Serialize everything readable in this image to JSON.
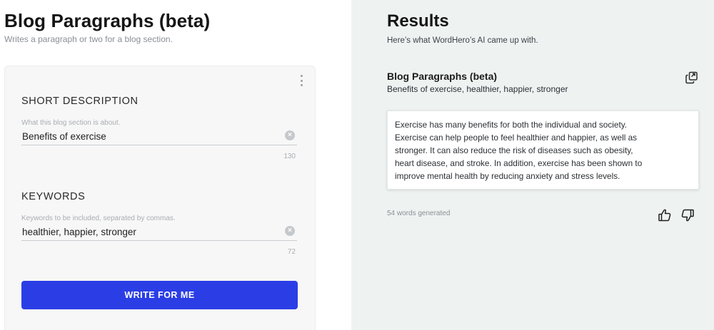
{
  "left": {
    "title": "Blog Paragraphs (beta)",
    "subtitle": "Writes a paragraph or two for a blog section.",
    "menu_icon": "kebab-vertical-icon",
    "short_description": {
      "label": "SHORT DESCRIPTION",
      "hint": "What this blog section is about.",
      "value": "Benefits of exercise",
      "counter": "130"
    },
    "keywords": {
      "label": "KEYWORDS",
      "hint": "Keywords to be included, separated by commas.",
      "value": "healthier, happier, stronger",
      "counter": "72"
    },
    "write_button_label": "WRITE FOR ME",
    "accent_color": "#2b3ee6"
  },
  "right": {
    "title": "Results",
    "subtitle": "Here’s what WordHero’s AI came up with.",
    "result": {
      "heading": "Blog Paragraphs (beta)",
      "keywords": "Benefits of exercise, healthier, happier, stronger",
      "lines": [
        "Exercise has many benefits for both the individual and society.",
        "Exercise can help people to feel healthier and happier, as well as",
        "stronger. It can also reduce the risk of diseases such as obesity,",
        "heart disease, and stroke. In addition, exercise has been shown to",
        "improve mental health by reducing anxiety and stress levels."
      ],
      "words_generated": "54 words generated",
      "icons": [
        "copy-icon",
        "thumbs-up-icon",
        "thumbs-down-icon"
      ]
    },
    "background_color": "#eef2f1"
  }
}
